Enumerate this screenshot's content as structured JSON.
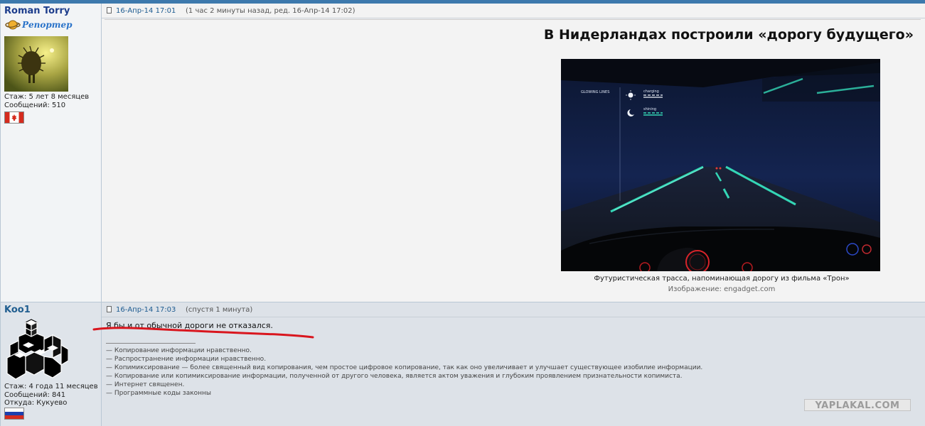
{
  "post1": {
    "username": "Roman Torry",
    "rank_label": "Репортер",
    "stats": [
      "Стаж: 5 лет 8 месяцев",
      "Сообщений: 510"
    ],
    "date": "16-Апр-14 17:01",
    "meta": "(1 час 2 минуты назад, ред. 16-Апр-14 17:02)",
    "title": "В Нидерландах построили «дорогу будущего»",
    "image": {
      "legend_title": "GLOWING LINES",
      "legend_charging": "charging",
      "legend_shining": "shining"
    },
    "caption": "Футуристическая трасса, напоминающая дорогу из фильма «Трон»",
    "credit": "Изображение: engadget.com"
  },
  "post2": {
    "username": "Koo1",
    "stats": [
      "Стаж: 4 года 11 месяцев",
      "Сообщений: 841",
      "Откуда: Кукуево"
    ],
    "date": "16-Апр-14 17:03",
    "meta": "(спустя 1 минута)",
    "message": "Я бы и от обычной дороги не отказался.",
    "signature": [
      "— Копирование информации нравственно.",
      "— Распространение информации нравственно.",
      "— Копимиксирование — более священный вид копирования, чем простое цифровое копирование, так как оно увеличивает и улучшает существующее изобилие информации.",
      "— Копирование или копимиксирование информации, полученной от другого человека, является актом уважения и глубоким проявлением признательности копимиста.",
      "— Интернет священен.",
      "— Программные коды законны"
    ]
  },
  "watermark": "YAPLAKAL.COM",
  "colors": {
    "accent": "#3d79ad",
    "username": "#1d3d8c",
    "link": "#1d5b90",
    "underline": "#d9161e",
    "glow": "#34d6b6"
  }
}
